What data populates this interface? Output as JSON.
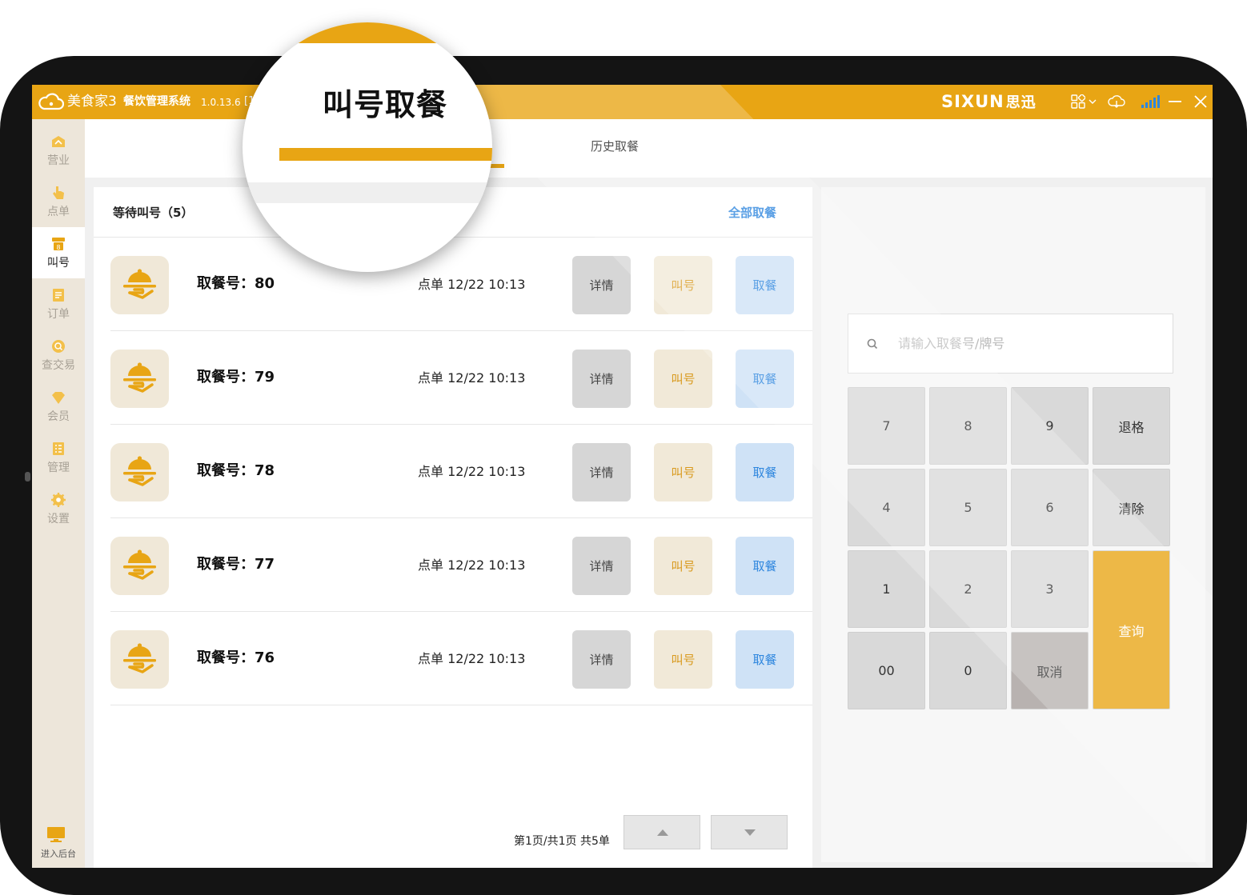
{
  "app": {
    "brand": "美食家3",
    "system_name": "餐饮管理系统",
    "version": "1.0.13.6",
    "bracket": "[1",
    "vendor": "SIXUN",
    "vendor_cn": "思迅",
    "accent": "#e8a514"
  },
  "titlebar_icons": [
    "apps-grid-icon",
    "chevron-down-icon",
    "cloud-sync-icon",
    "signal-icon",
    "minimize-icon",
    "close-icon"
  ],
  "sidebar": {
    "items": [
      {
        "label": "营业",
        "icon": "shop-icon"
      },
      {
        "label": "点单",
        "icon": "tap-hand-icon"
      },
      {
        "label": "叫号",
        "icon": "call-number-icon"
      },
      {
        "label": "订单",
        "icon": "order-list-icon"
      },
      {
        "label": "查交易",
        "icon": "query-transaction-icon"
      },
      {
        "label": "会员",
        "icon": "diamond-icon"
      },
      {
        "label": "管理",
        "icon": "manage-icon"
      },
      {
        "label": "设置",
        "icon": "gear-icon"
      }
    ],
    "active": "叫号",
    "backend_label": "进入后台"
  },
  "tabs": {
    "active_label": "叫号取餐",
    "history_label": "历史取餐"
  },
  "queue": {
    "title": "等待叫号（5）",
    "take_all_label": "全部取餐",
    "rows": [
      {
        "number_label": "取餐号：80",
        "time_label": "点单 12/22 10:13",
        "detail": "详情",
        "call": "叫号",
        "take": "取餐"
      },
      {
        "number_label": "取餐号：79",
        "time_label": "点单 12/22 10:13",
        "detail": "详情",
        "call": "叫号",
        "take": "取餐"
      },
      {
        "number_label": "取餐号：78",
        "time_label": "点单 12/22 10:13",
        "detail": "详情",
        "call": "叫号",
        "take": "取餐"
      },
      {
        "number_label": "取餐号：77",
        "time_label": "点单 12/22 10:13",
        "detail": "详情",
        "call": "叫号",
        "take": "取餐"
      },
      {
        "number_label": "取餐号：76",
        "time_label": "点单 12/22 10:13",
        "detail": "详情",
        "call": "叫号",
        "take": "取餐"
      }
    ]
  },
  "pager": {
    "text": "第1页/共1页 共5单"
  },
  "search": {
    "placeholder": "请输入取餐号/牌号"
  },
  "keypad": {
    "k7": "7",
    "k8": "8",
    "k9": "9",
    "backspace": "退格",
    "k4": "4",
    "k5": "5",
    "k6": "6",
    "clear": "清除",
    "k1": "1",
    "k2": "2",
    "k3": "3",
    "query": "查询",
    "k00": "00",
    "k0": "0",
    "cancel": "取消"
  }
}
